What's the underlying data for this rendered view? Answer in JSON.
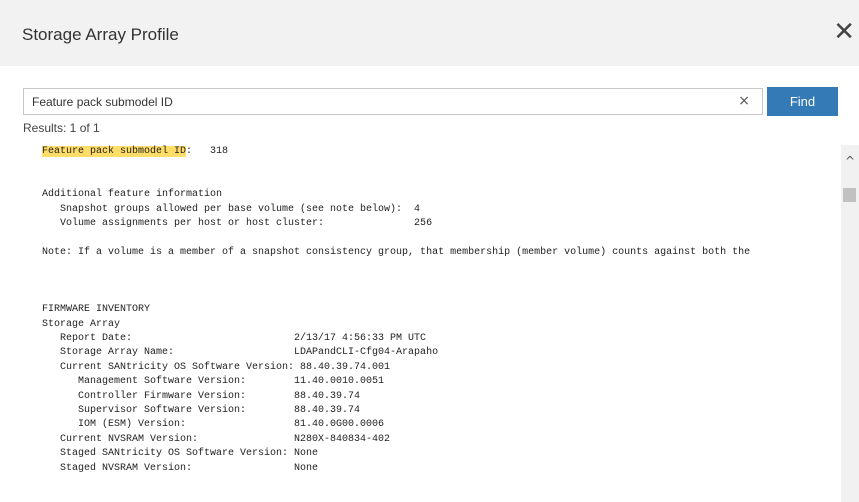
{
  "dialog": {
    "title": "Storage Array Profile",
    "close_glyph": "✕",
    "close_icon": "close-icon"
  },
  "search": {
    "value": "Feature pack submodel ID",
    "placeholder": "",
    "clear_glyph": "×",
    "find_label": "Find"
  },
  "results_text": "Results: 1 of 1",
  "colors": {
    "find_button": "#337ab7",
    "highlight": "#ffdd66",
    "header_bg": "#f2f2f2"
  },
  "profile": {
    "highlight_term": "Feature pack submodel ID",
    "lines": [
      {
        "hl": "Feature pack submodel ID",
        "rest": ":   318"
      },
      {
        "text": ""
      },
      {
        "text": ""
      },
      {
        "text": "Additional feature information"
      },
      {
        "text": "   Snapshot groups allowed per base volume (see note below):  4"
      },
      {
        "text": "   Volume assignments per host or host cluster:               256"
      },
      {
        "text": ""
      },
      {
        "text": "Note: If a volume is a member of a snapshot consistency group, that membership (member volume) counts against both the"
      },
      {
        "text": ""
      },
      {
        "text": ""
      },
      {
        "text": ""
      },
      {
        "text": "FIRMWARE INVENTORY"
      },
      {
        "text": "Storage Array"
      },
      {
        "text": "   Report Date:                           2/13/17 4:56:33 PM UTC"
      },
      {
        "text": "   Storage Array Name:                    LDAPandCLI-Cfg04-Arapaho"
      },
      {
        "text": "   Current SANtricity OS Software Version: 88.40.39.74.001"
      },
      {
        "text": "      Management Software Version:        11.40.0010.0051"
      },
      {
        "text": "      Controller Firmware Version:        88.40.39.74"
      },
      {
        "text": "      Supervisor Software Version:        88.40.39.74"
      },
      {
        "text": "      IOM (ESM) Version:                  81.40.0G00.0006"
      },
      {
        "text": "   Current NVSRAM Version:                N280X-840834-402"
      },
      {
        "text": "   Staged SANtricity OS Software Version: None"
      },
      {
        "text": "   Staged NVSRAM Version:                 None"
      }
    ]
  },
  "scrollbar": {
    "up_glyph": "^"
  }
}
